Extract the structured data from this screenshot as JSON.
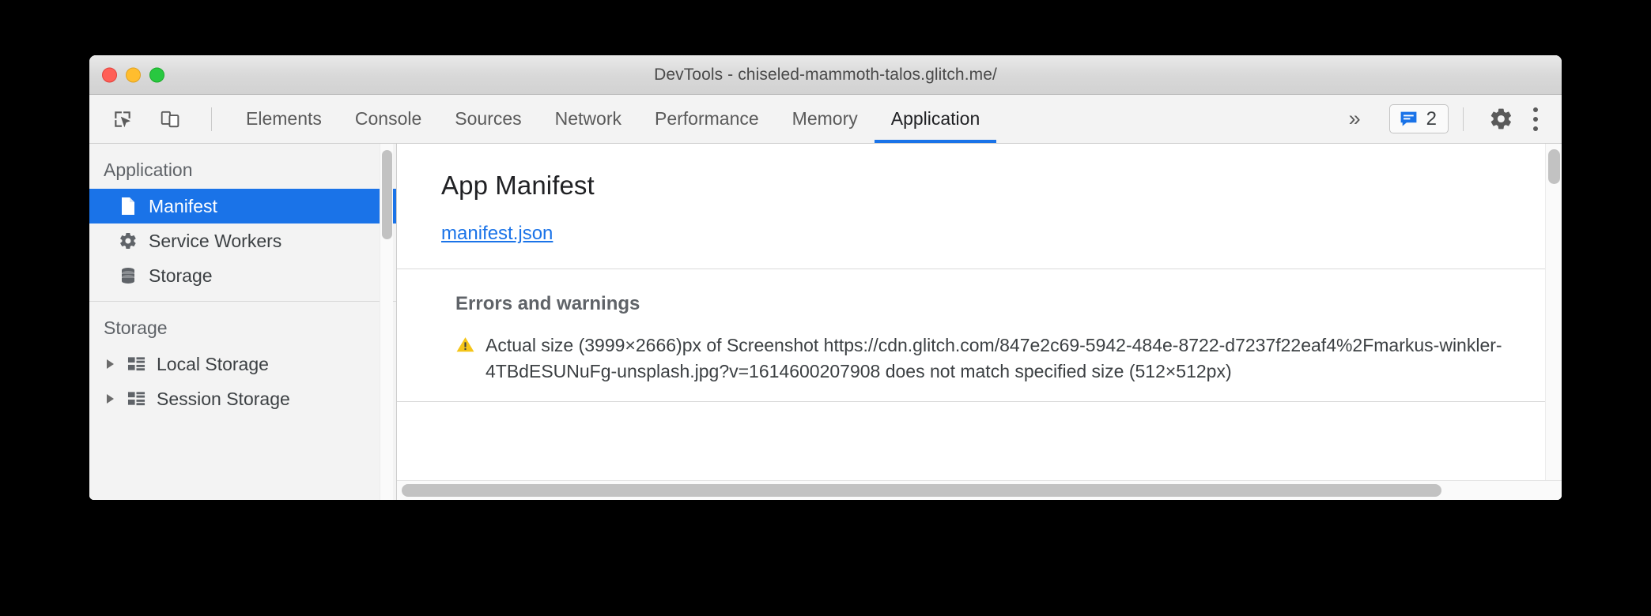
{
  "window": {
    "title": "DevTools - chiseled-mammoth-talos.glitch.me/",
    "traffic_lights": {
      "close_label": "close",
      "minimize_label": "minimize",
      "maximize_label": "maximize"
    }
  },
  "toolbar": {
    "inspect_icon": "inspect-element-icon",
    "device_toolbar_icon": "device-toolbar-icon",
    "more_tabs_label": "»",
    "messages": {
      "icon": "message-bubble-icon",
      "count": "2"
    },
    "settings_icon": "gear-icon",
    "menu_icon": "kebab-menu-icon"
  },
  "tabs": [
    {
      "label": "Elements",
      "active": false
    },
    {
      "label": "Console",
      "active": false
    },
    {
      "label": "Sources",
      "active": false
    },
    {
      "label": "Network",
      "active": false
    },
    {
      "label": "Performance",
      "active": false
    },
    {
      "label": "Memory",
      "active": false
    },
    {
      "label": "Application",
      "active": true
    }
  ],
  "sidebar": {
    "sections": [
      {
        "header": "Application",
        "items": [
          {
            "label": "Manifest",
            "icon": "document-icon",
            "selected": true,
            "expandable": false
          },
          {
            "label": "Service Workers",
            "icon": "gear-icon",
            "selected": false,
            "expandable": false
          },
          {
            "label": "Storage",
            "icon": "database-icon",
            "selected": false,
            "expandable": false
          }
        ]
      },
      {
        "header": "Storage",
        "items": [
          {
            "label": "Local Storage",
            "icon": "table-icon",
            "selected": false,
            "expandable": true
          },
          {
            "label": "Session Storage",
            "icon": "table-icon",
            "selected": false,
            "expandable": true
          }
        ]
      }
    ]
  },
  "main": {
    "panel_title": "App Manifest",
    "manifest_link": "manifest.json",
    "errors_title": "Errors and warnings",
    "warning_icon": "warning-triangle-icon",
    "warning_text": "Actual size (3999×2666)px of Screenshot https://cdn.glitch.com/847e2c69-5942-484e-8722-d7237f22eaf4%2Fmarkus-winkler-4TBdESUNuFg-unsplash.jpg?v=1614600207908 does not match specified size (512×512px)"
  },
  "colors": {
    "accent": "#1a73e8",
    "warning": "#f5c518",
    "link": "#1a73e8",
    "text": "#3c4043",
    "sidebar_bg": "#f3f3f3"
  }
}
